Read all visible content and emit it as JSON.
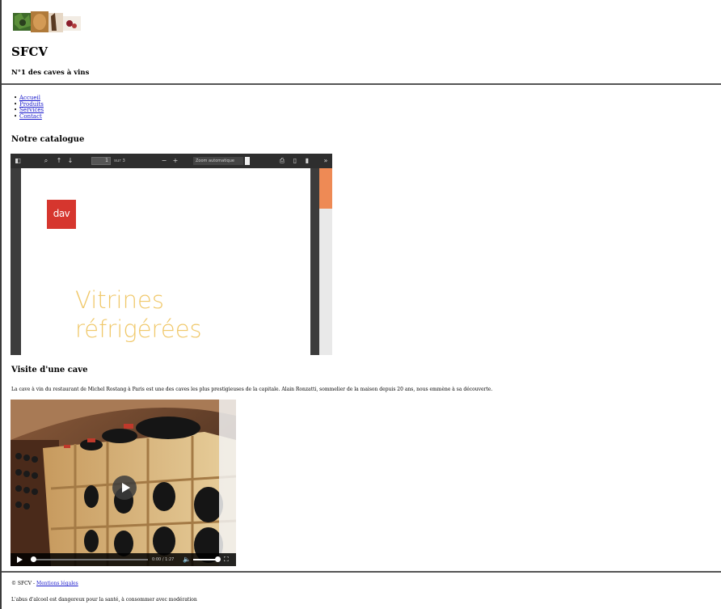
{
  "header": {
    "site_title": "SFCV",
    "tagline": "N°1 des caves à vins"
  },
  "nav": {
    "items": [
      {
        "label": "Accueil"
      },
      {
        "label": "Produits"
      },
      {
        "label": "Services"
      },
      {
        "label": "Contact"
      }
    ]
  },
  "catalogue": {
    "title": "Notre catalogue",
    "viewer": {
      "page_value": "1",
      "page_of": "sur 3",
      "zoom": "Zoom automatique",
      "icons": [
        "sidebar-toggle-icon",
        "search-icon",
        "previous-page-icon",
        "next-page-icon",
        "zoom-out-icon",
        "zoom-in-icon",
        "print-icon",
        "download-icon",
        "bookmark-icon",
        "more-tools-icon"
      ]
    },
    "document": {
      "logo_text": "dav",
      "headline_line1": "Vitrines",
      "headline_line2": "réfrigérées"
    }
  },
  "visit": {
    "title": "Visite d'une cave",
    "intro": "La cave à vin du restaurant de Michel Rostang à Paris est une des caves les plus prestigieuses de la capitale. Alain Ronzatti, sommelier de la maison depuis 20 ans, nous emmène à sa découverte.",
    "video": {
      "time": "0:00 / 1:27",
      "progress": 0
    }
  },
  "footer": {
    "copyright": "© SFCV - ",
    "legal_link": "Mentions légales",
    "warning": "L'abus d'alcool est dangereux pour la santé, à consommer avec modération"
  },
  "colors": {
    "link": "#1a1acc",
    "brand_red": "#d6362e",
    "headline_gold": "#f0c86a",
    "scroll_accent": "#ee8a55"
  }
}
